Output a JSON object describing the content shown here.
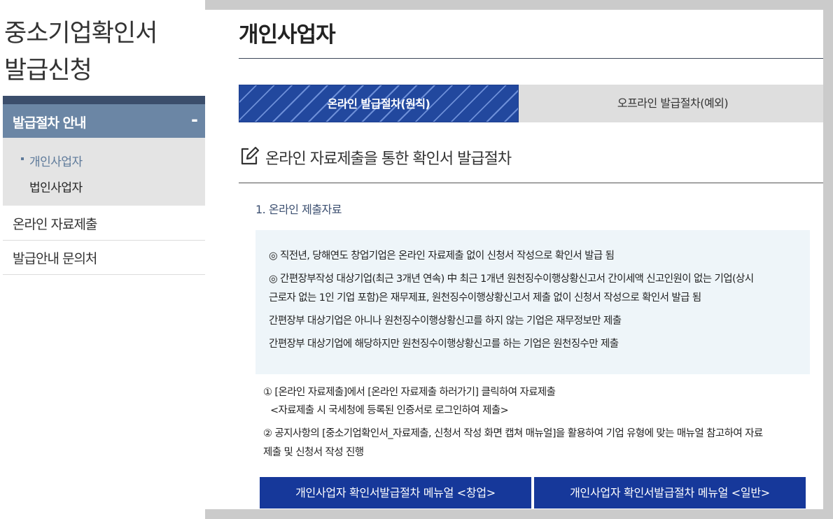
{
  "sidebar": {
    "title_line1": "중소기업확인서",
    "title_line2": "발급신청",
    "section_header": "발급절차 안내",
    "collapse_symbol": "-",
    "sub_items": [
      "개인사업자",
      "법인사업자"
    ],
    "links": [
      "온라인 자료제출",
      "발급안내 문의처"
    ]
  },
  "main": {
    "page_title": "개인사업자",
    "tabs": [
      "온라인 발급절차(원칙)",
      "오프라인 발급절차(예외)"
    ],
    "section_heading": "온라인 자료제출을 통한 확인서 발급절차",
    "step_title": "1. 온라인 제출자료",
    "info_lines": [
      "◎ 직전년, 당해연도 창업기업은 온라인 자료제출 없이 신청서 작성으로 확인서 발급 됨",
      "◎ 간편장부작성 대상기업(최근 3개년 연속) 中 최근 1개년 원천징수이행상황신고서 간이세액 신고인원이 없는 기업(상시",
      "근로자 없는 1인 기업 포함)은 재무제표, 원천징수이행상황신고서 제출 없이 신청서 작성으로 확인서 발급 됨",
      "간편장부 대상기업은 아니나 원천징수이행상황신고를 하지 않는 기업은 재무정보만 제출",
      "간편장부 대상기업에 해당하지만 원천징수이행상황신고를 하는 기업은 원천징수만 제출"
    ],
    "steps": [
      "① [온라인 자료제출]에서 [온라인 자료제출 하러가기] 클릭하여 자료제출",
      "<자료제출 시 국세청에 등록된 인증서로 로그인하여 제출>",
      "② 공지사항의 [중소기업확인서_자료제출, 신청서 작성 화면 캡쳐 매뉴얼]을 활용하여 기업 유형에 맞는 매뉴얼 참고하여 자료",
      "제출 및 신청서 작성 진행"
    ],
    "buttons": [
      "개인사업자 확인서발급절차 메뉴얼 <창업>",
      "개인사업자 확인서발급절차 메뉴얼 <일반>"
    ]
  },
  "colors": {
    "background": "#cbcbcb",
    "sidebar_header": "#6b86a5",
    "tab_active": "#22489e",
    "button": "#16389a",
    "info_box": "#eef5f9"
  }
}
